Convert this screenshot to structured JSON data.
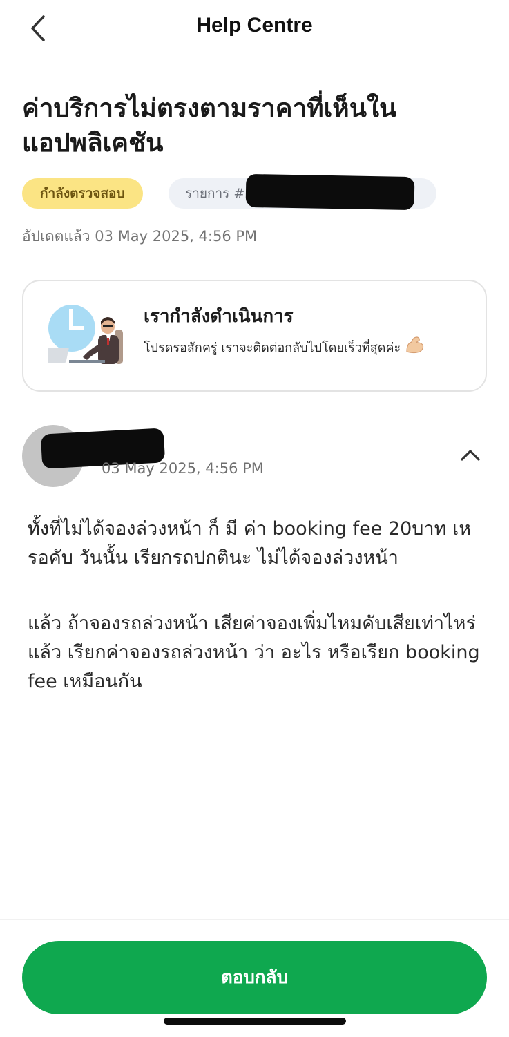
{
  "header": {
    "title": "Help Centre",
    "back_icon": "chevron-left-icon"
  },
  "ticket": {
    "title": "ค่าบริการไม่ตรงตามราคาที่เห็นในแอปพลิเคชัน",
    "status": "กำลังตรวจสอบ",
    "reference_prefix": "รายการ #",
    "updated": "อัปเดตแล้ว 03 May 2025, 4:56 PM"
  },
  "status_card": {
    "title": "เรากำลังดำเนินการ",
    "text": "โปรดรอสักครู่ เราจะติดต่อกลับไปโดยเร็วที่สุดค่ะ",
    "emoji_icon": "flexed-biceps-icon"
  },
  "message": {
    "timestamp": "03 May 2025, 4:56 PM",
    "collapse_icon": "chevron-up-icon",
    "paragraphs": [
      "ทั้งที่ไม่ได้จองล่วงหน้า ก็ มี ค่า booking fee 20บาท เหรอคับ วันนั้น เรียกรถปกตินะ ไม่ได้จองล่วงหน้า",
      "แล้ว ถ้าจองรถล่วงหน้า เสียค่าจองเพิ่มไหมคับเสียเท่าไหร่ แล้ว เรียกค่าจองรถล่วงหน้า ว่า อะไร หรือเรียก booking fee เหมือนกัน"
    ]
  },
  "footer": {
    "reply_label": "ตอบกลับ"
  },
  "colors": {
    "accent_green": "#0fa84f",
    "status_yellow": "#fbe484",
    "reference_pill": "#eef1f6"
  }
}
